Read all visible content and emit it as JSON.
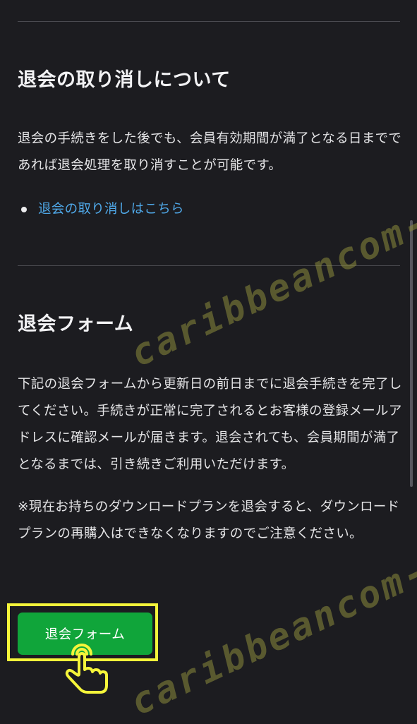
{
  "section_cancel": {
    "heading": "退会の取り消しについて",
    "body": "退会の手続きをした後でも、会員有効期間が満了となる日までであれば退会処理を取り消すことが可能です。",
    "link_label": "退会の取り消しはこちら"
  },
  "section_form": {
    "heading": "退会フォーム",
    "body": "下記の退会フォームから更新日の前日までに退会手続きを完了してください。手続きが正常に完了されるとお客様の登録メールアドレスに確認メールが届きます。退会されても、会員期間が満了となるまでは、引き続きご利用いただけます。",
    "note": "※現在お持ちのダウンロードプランを退会すると、ダウンロードプランの再購入はできなくなりますのでご注意ください。",
    "button_label": "退会フォーム"
  },
  "watermark": {
    "text": "caribbeancom-cou"
  },
  "colors": {
    "background": "#1c1c20",
    "link": "#4fa8e8",
    "button": "#10a53a",
    "highlight": "#f5f53a"
  },
  "icons": {
    "pointer": "hand-pointer-icon",
    "bullet": "bullet-dot-icon"
  }
}
